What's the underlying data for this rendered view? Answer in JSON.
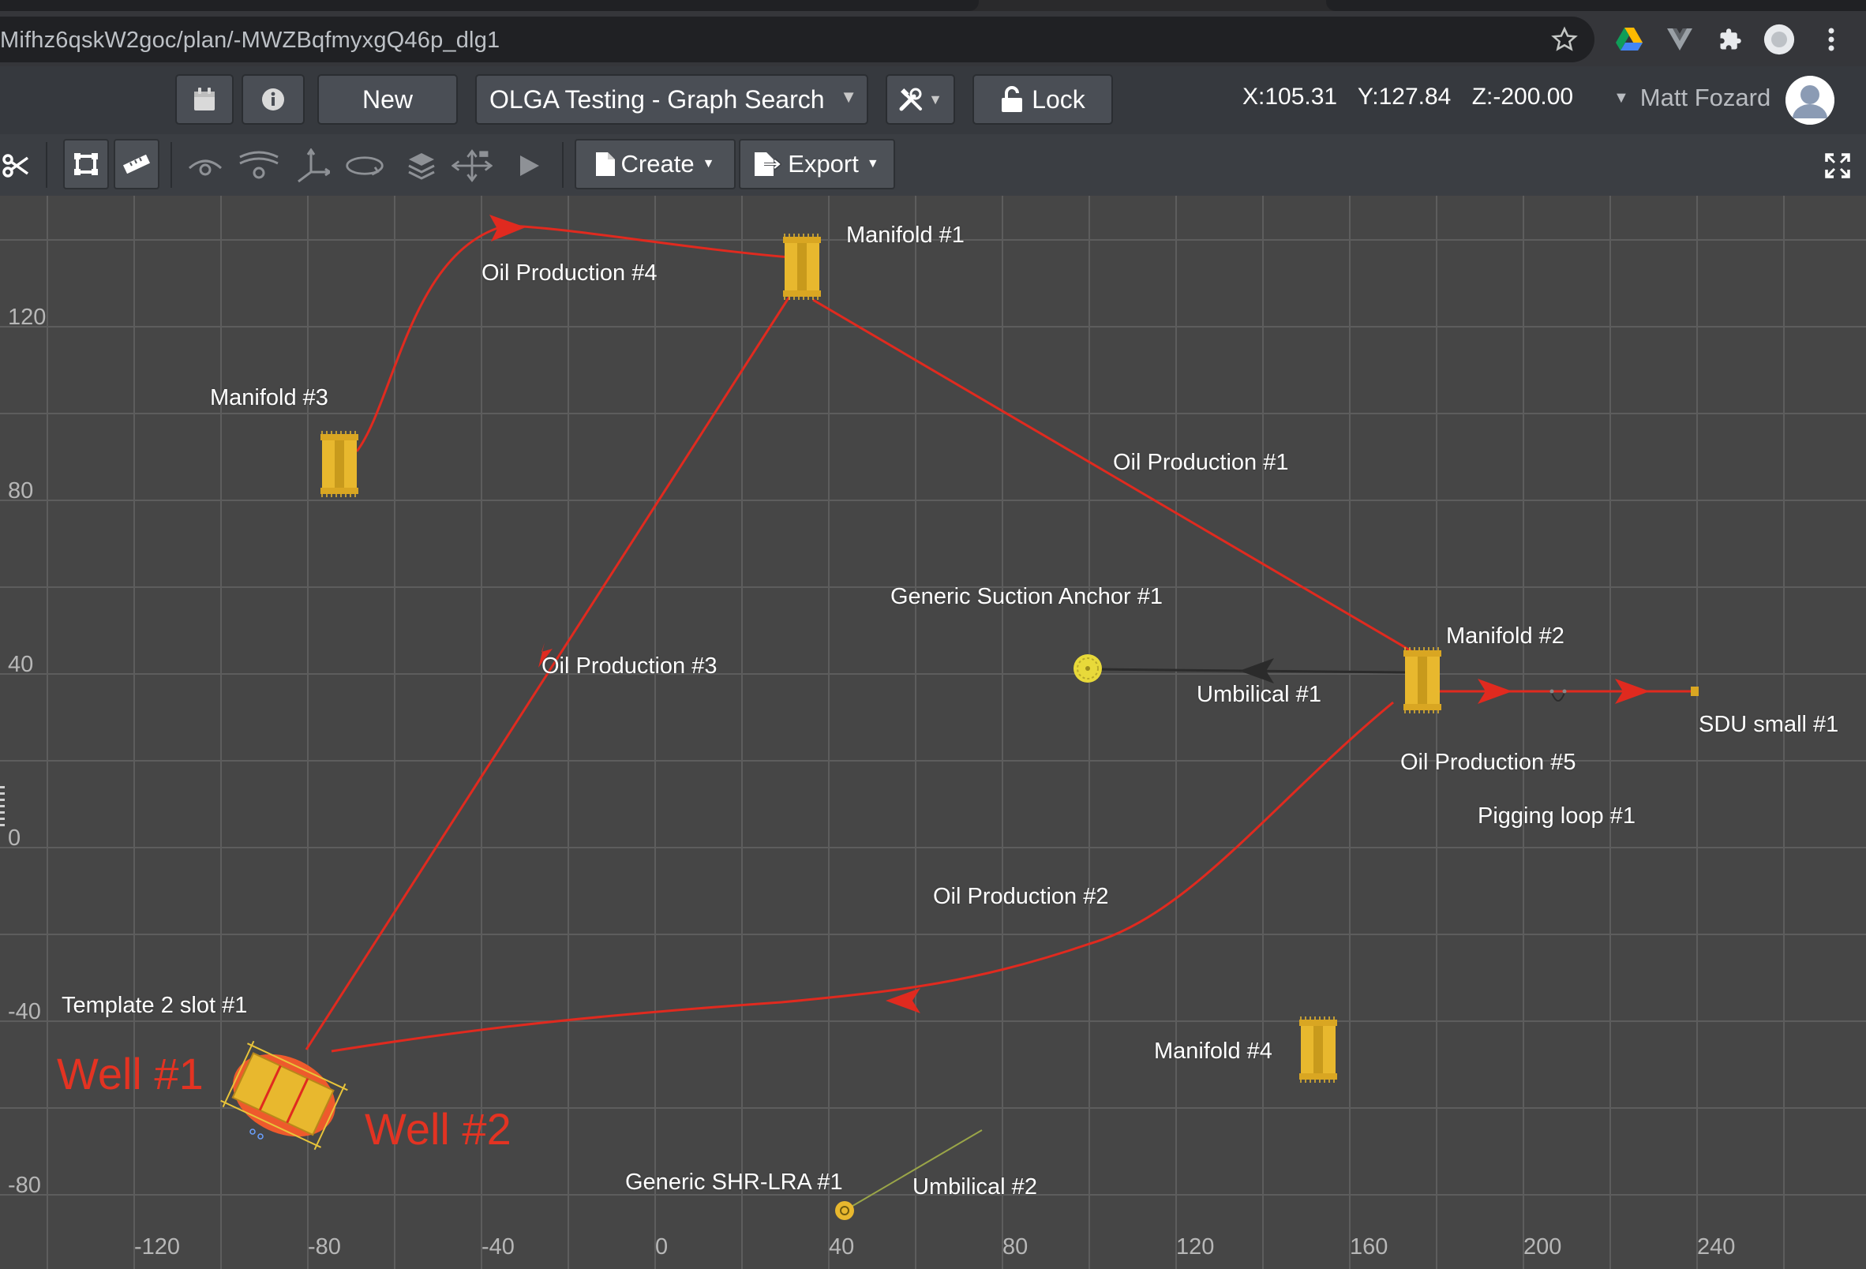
{
  "browser": {
    "url": "Mifhz6qskW2goc/plan/-MWZBqfmyxgQ46p_dlg1",
    "icons": [
      "star-icon",
      "drive-icon",
      "vue-devtools-icon",
      "extensions-icon",
      "profile-icon",
      "kebab-menu-icon"
    ]
  },
  "header": {
    "new_label": "New",
    "project_select": "OLGA Testing - Graph Search",
    "lock_label": "Lock",
    "coords": {
      "x": "X:105.31",
      "y": "Y:127.84",
      "z": "Z:-200.00"
    },
    "user_name": "Matt Fozard"
  },
  "toolbar": {
    "create_label": "Create",
    "export_label": "Export"
  },
  "canvas": {
    "x_axis_ticks": [
      "-120",
      "-80",
      "-40",
      "0",
      "40",
      "80",
      "120",
      "160",
      "200",
      "240"
    ],
    "y_axis_ticks": [
      "120",
      "80",
      "40",
      "0",
      "-40",
      "-80"
    ],
    "labels": {
      "manifold1": "Manifold #1",
      "manifold2": "Manifold #2",
      "manifold3": "Manifold #3",
      "manifold4": "Manifold #4",
      "oil1": "Oil Production #1",
      "oil2": "Oil Production #2",
      "oil3": "Oil Production #3",
      "oil4": "Oil Production #4",
      "oil5": "Oil Production #5",
      "anchor": "Generic Suction Anchor #1",
      "umb1": "Umbilical #1",
      "umb2": "Umbilical #2",
      "sdu": "SDU small #1",
      "pig": "Pigging loop #1",
      "template": "Template 2 slot #1",
      "shr": "Generic SHR-LRA #1",
      "well1": "Well #1",
      "well2": "Well #2"
    },
    "colors": {
      "flowline": "#e02a1f",
      "umbilical_dark": "#2b2b2b",
      "umbilical_light": "#9aa548",
      "equipment": "#e8b82e",
      "well": "#ee5a2c",
      "grid": "#5e5e5e"
    }
  }
}
